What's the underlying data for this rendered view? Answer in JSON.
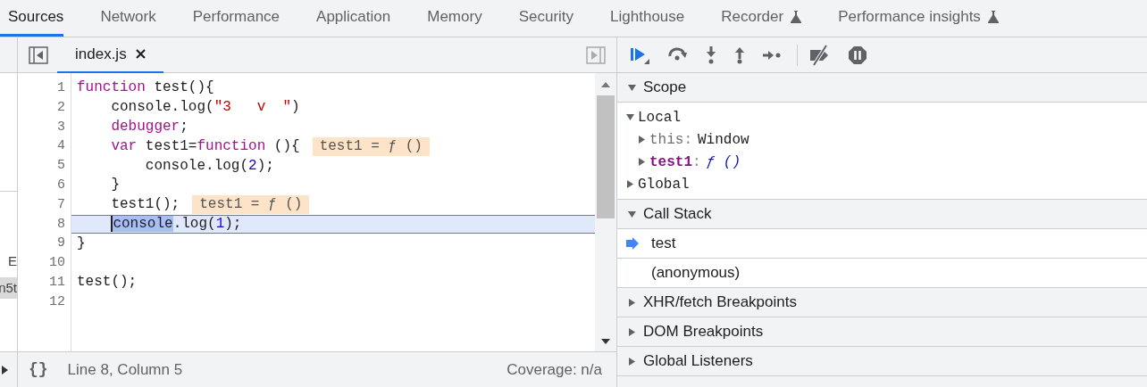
{
  "tabs": [
    {
      "label": "Sources",
      "selected": true,
      "experimental": false
    },
    {
      "label": "Network",
      "selected": false,
      "experimental": false
    },
    {
      "label": "Performance",
      "selected": false,
      "experimental": false
    },
    {
      "label": "Application",
      "selected": false,
      "experimental": false
    },
    {
      "label": "Memory",
      "selected": false,
      "experimental": false
    },
    {
      "label": "Security",
      "selected": false,
      "experimental": false
    },
    {
      "label": "Lighthouse",
      "selected": false,
      "experimental": false
    },
    {
      "label": "Recorder",
      "selected": false,
      "experimental": true
    },
    {
      "label": "Performance insights",
      "selected": false,
      "experimental": true
    }
  ],
  "navigator_strip": {
    "texts": [
      {
        "text": "E",
        "highlighted": false
      },
      {
        "text": "n5t",
        "highlighted": true
      }
    ]
  },
  "editor": {
    "file_tabs": [
      {
        "label": "index.js",
        "selected": true
      }
    ],
    "lines": [
      {
        "number": "1",
        "current": false,
        "tokens": [
          {
            "kind": "keyword",
            "text": "function"
          },
          {
            "kind": "plain",
            "text": " test(){"
          }
        ]
      },
      {
        "number": "2",
        "current": false,
        "tokens": [
          {
            "kind": "plain",
            "text": "    console.log("
          },
          {
            "kind": "string",
            "text": "\"3   v  \""
          },
          {
            "kind": "plain",
            "text": ")"
          }
        ]
      },
      {
        "number": "3",
        "current": false,
        "tokens": [
          {
            "kind": "keyword",
            "text": "    debugger"
          },
          {
            "kind": "plain",
            "text": ";"
          }
        ]
      },
      {
        "number": "4",
        "current": false,
        "tokens": [
          {
            "kind": "keyword",
            "text": "    var"
          },
          {
            "kind": "plain",
            "text": " test1="
          },
          {
            "kind": "keyword",
            "text": "function"
          },
          {
            "kind": "plain",
            "text": " (){"
          }
        ],
        "inline_value": "test1 = ƒ ()"
      },
      {
        "number": "5",
        "current": false,
        "tokens": [
          {
            "kind": "plain",
            "text": "        console.log("
          },
          {
            "kind": "number",
            "text": "2"
          },
          {
            "kind": "plain",
            "text": ");"
          }
        ]
      },
      {
        "number": "6",
        "current": false,
        "tokens": [
          {
            "kind": "plain",
            "text": "    }"
          }
        ]
      },
      {
        "number": "7",
        "current": false,
        "tokens": [
          {
            "kind": "plain",
            "text": "    test1();"
          }
        ],
        "inline_value": "test1 = ƒ ()"
      },
      {
        "number": "8",
        "current": true,
        "indented": true,
        "tokens": [
          {
            "kind": "selection",
            "text": "console"
          },
          {
            "kind": "plain",
            "text": ".log("
          },
          {
            "kind": "number",
            "text": "1"
          },
          {
            "kind": "plain",
            "text": ");"
          }
        ]
      },
      {
        "number": "9",
        "current": false,
        "tokens": [
          {
            "kind": "plain",
            "text": "}"
          }
        ]
      },
      {
        "number": "10",
        "current": false
      },
      {
        "number": "11",
        "current": false,
        "tokens": [
          {
            "kind": "plain",
            "text": "test();"
          }
        ]
      },
      {
        "number": "12",
        "current": false
      }
    ],
    "status_bar": {
      "format_button": "{}",
      "position": "Line 8, Column 5",
      "coverage": "Coverage: n/a"
    }
  },
  "scope": {
    "title": "Scope",
    "expanded": true,
    "items": [
      {
        "name": "Local",
        "kind": "scope",
        "expanded": true,
        "children": [
          {
            "name": "this",
            "kind": "receiver",
            "separator": ":",
            "value": "Window",
            "expanded": false
          },
          {
            "name": "test1",
            "kind": "function",
            "separator": ":",
            "value": "ƒ ()",
            "expanded": false
          }
        ]
      },
      {
        "name": "Global",
        "kind": "scope",
        "expanded": false
      }
    ]
  },
  "call_stack": {
    "title": "Call Stack",
    "expanded": true,
    "frames": [
      {
        "label": "test",
        "selected": true
      },
      {
        "label": "(anonymous)",
        "selected": false
      }
    ]
  },
  "sections": [
    {
      "title": "XHR/fetch Breakpoints",
      "expanded": false
    },
    {
      "title": "DOM Breakpoints",
      "expanded": false
    },
    {
      "title": "Global Listeners",
      "expanded": false
    }
  ]
}
